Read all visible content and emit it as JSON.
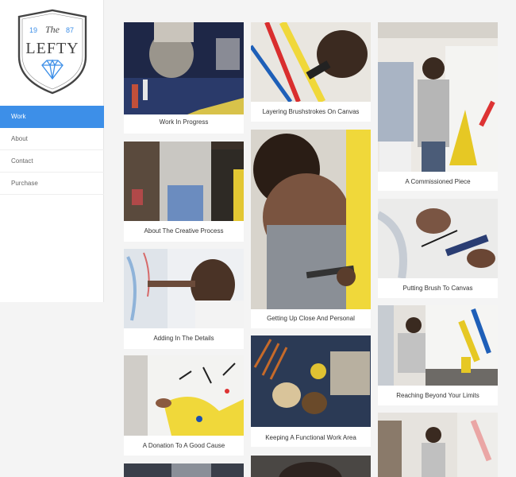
{
  "logo": {
    "word_the": "The",
    "year_left": "19",
    "year_right": "87",
    "name": "LEFTY",
    "accent": "#3d8fe8"
  },
  "nav": {
    "items": [
      {
        "label": "Work",
        "active": true
      },
      {
        "label": "About",
        "active": false
      },
      {
        "label": "Contact",
        "active": false
      },
      {
        "label": "Purchase",
        "active": false
      }
    ]
  },
  "gallery": {
    "items": [
      {
        "caption": "Work In Progress"
      },
      {
        "caption": "About The Creative Process"
      },
      {
        "caption": "Adding In The Details"
      },
      {
        "caption": "A Donation To A Good Cause"
      },
      {
        "caption": "Layering Brushstrokes On Canvas"
      },
      {
        "caption": "Getting Up Close And Personal"
      },
      {
        "caption": "Keeping A Functional Work Area"
      },
      {
        "caption": "A Commissioned Piece"
      },
      {
        "caption": "Putting Brush To Canvas"
      },
      {
        "caption": "Reaching Beyond Your Limits"
      }
    ]
  },
  "colors": {
    "accent": "#3d8fe8",
    "background": "#f4f4f4"
  }
}
